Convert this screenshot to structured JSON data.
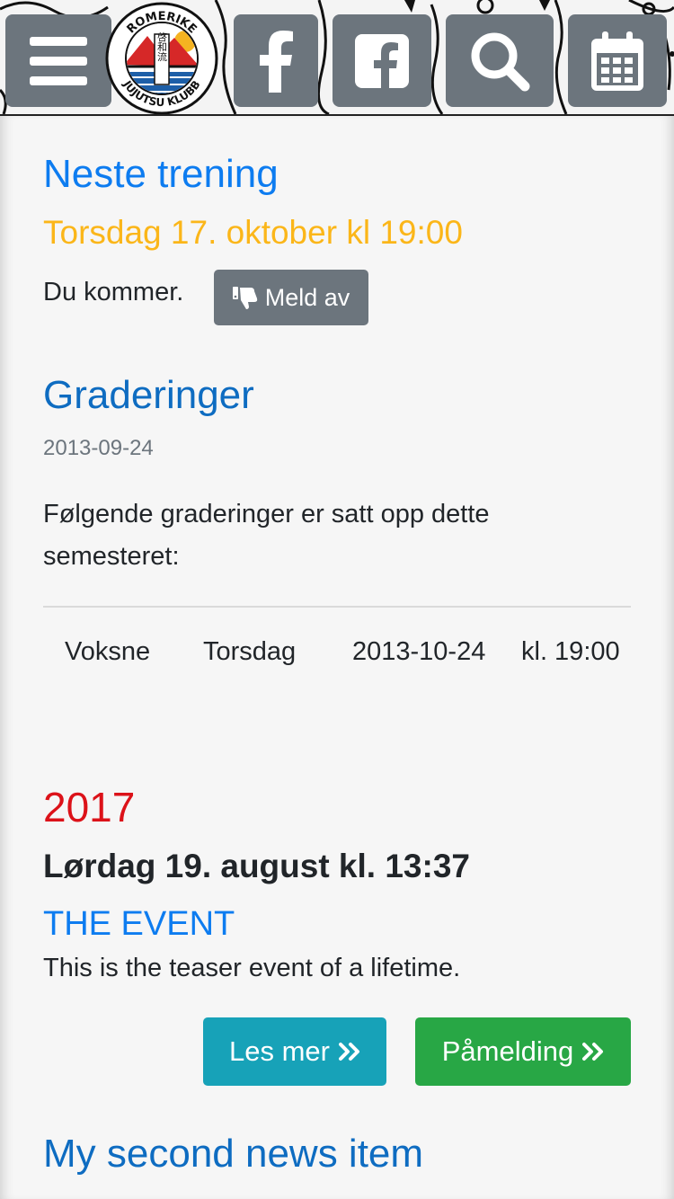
{
  "header": {
    "logo_text_top": "ROMERIKE",
    "logo_text_bottom": "JUJUTSU KLUBB",
    "logo_kanji": "啓和流",
    "nav": [
      {
        "icon": "menu-icon"
      },
      {
        "icon": "facebook-f-icon"
      },
      {
        "icon": "facebook-square-icon"
      },
      {
        "icon": "search-icon"
      },
      {
        "icon": "calendar-icon"
      }
    ]
  },
  "next_training": {
    "title": "Neste trening",
    "date": "Torsdag 17. oktober kl 19:00",
    "status": "Du kommer.",
    "cancel_button": "Meld av",
    "cancel_icon": "thumbs-down-icon"
  },
  "gradings": {
    "title": "Graderinger",
    "published": "2013-09-24",
    "text": "Følgende graderinger er satt opp dette semesteret:",
    "rows": [
      {
        "group": "Voksne",
        "day": "Torsdag",
        "date": "2013-10-24",
        "time": "kl. 19:00"
      }
    ]
  },
  "event": {
    "year": "2017",
    "date": "Lørdag 19. august kl. 13:37",
    "title": "THE EVENT",
    "teaser": "This is the teaser event of a lifetime.",
    "read_more": "Les mer",
    "signup": "Påmelding",
    "button_icon": "double-chevron-right-icon"
  },
  "news": [
    {
      "title": "My second news item"
    }
  ],
  "colors": {
    "primary": "#0d7cf0",
    "heading_navy": "#0e6cc1",
    "warning": "#fbb619",
    "danger": "#dc1219",
    "secondary": "#6c757d",
    "info": "#17a2b8",
    "success": "#28a745"
  }
}
